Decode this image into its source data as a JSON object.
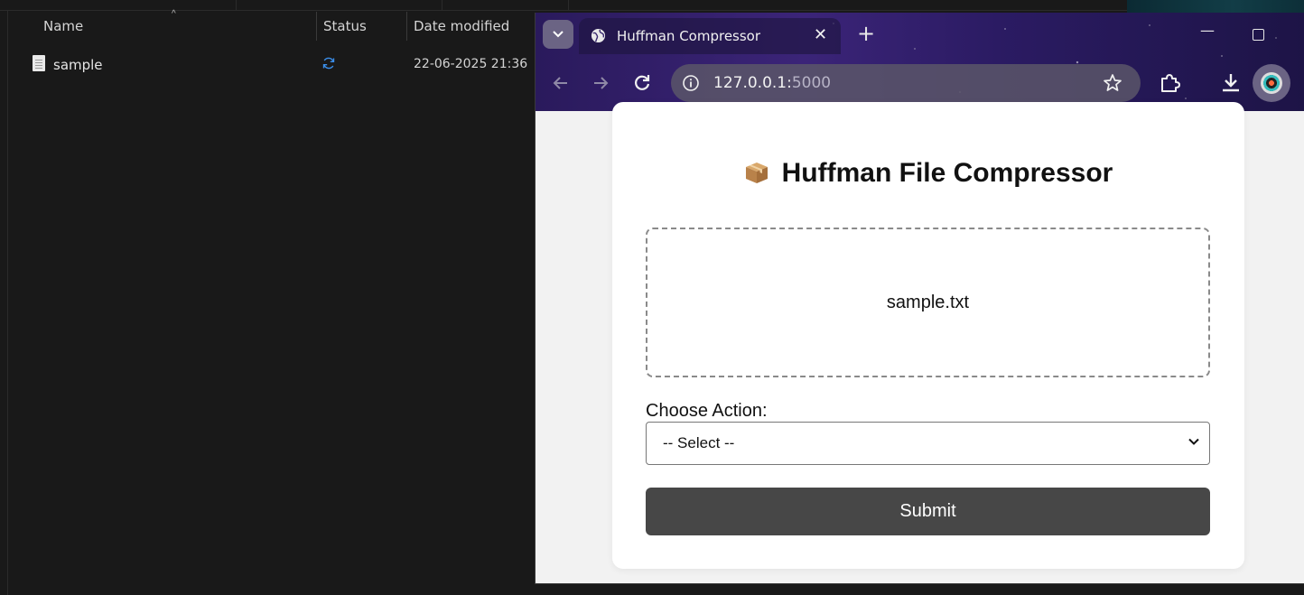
{
  "explorer": {
    "columns": {
      "name": "Name",
      "status": "Status",
      "date_modified": "Date modified"
    },
    "files": [
      {
        "name": "sample",
        "status_icon": "sync-pending-icon",
        "date_modified": "22-06-2025 21:36"
      }
    ]
  },
  "browser": {
    "tab_title": "Huffman Compressor",
    "tab_icon": "globe-icon",
    "address": {
      "host": "127.0.0.1:",
      "port": "5000"
    },
    "accent_frame_color": "#2b1b63"
  },
  "page": {
    "heading": "Huffman File Compressor",
    "heading_icon": "package-box-icon",
    "dropzone_text": "sample.txt",
    "action_label": "Choose Action:",
    "select_value": "-- Select --",
    "submit_label": "Submit",
    "submit_color": "#474747"
  }
}
